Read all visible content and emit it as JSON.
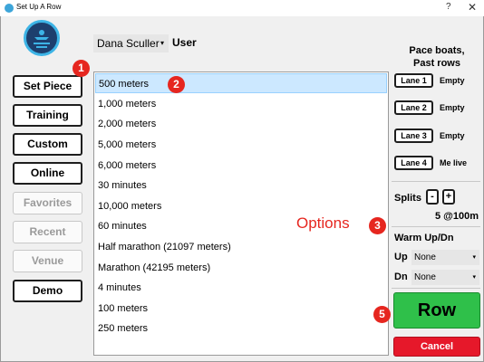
{
  "window": {
    "title": "Set Up A Row",
    "help_glyph": "?",
    "close_glyph": "✕"
  },
  "user": {
    "selected": "Dana Sculler",
    "label": "User"
  },
  "menu": [
    {
      "label": "Set Piece",
      "enabled": true
    },
    {
      "label": "Training",
      "enabled": true
    },
    {
      "label": "Custom",
      "enabled": true
    },
    {
      "label": "Online",
      "enabled": true
    },
    {
      "label": "Favorites",
      "enabled": false
    },
    {
      "label": "Recent",
      "enabled": false
    },
    {
      "label": "Venue",
      "enabled": false
    },
    {
      "label": "Demo",
      "enabled": true
    }
  ],
  "list": {
    "selected_index": 0,
    "items": [
      "500 meters",
      "1,000 meters",
      "2,000 meters",
      "5,000 meters",
      "6,000 meters",
      "30 minutes",
      "10,000 meters",
      "60 minutes",
      "Half marathon (21097 meters)",
      "Marathon (42195 meters)",
      "4 minutes",
      "100 meters",
      "250 meters"
    ]
  },
  "pace": {
    "heading_line1": "Pace boats,",
    "heading_line2": "Past rows",
    "lanes": [
      {
        "label": "Lane 1",
        "status": "Empty"
      },
      {
        "label": "Lane 2",
        "status": "Empty"
      },
      {
        "label": "Lane 3",
        "status": "Empty"
      },
      {
        "label": "Lane 4",
        "status": "Me live"
      }
    ]
  },
  "splits": {
    "label": "Splits",
    "minus": "-",
    "plus": "+",
    "value": "5 @100m"
  },
  "warmup": {
    "label": "Warm Up/Dn",
    "up_label": "Up",
    "up_value": "None",
    "dn_label": "Dn",
    "dn_value": "None"
  },
  "actions": {
    "row": "Row",
    "cancel": "Cancel"
  },
  "annotations": {
    "badge1": "1",
    "badge2": "2",
    "badge3": "3",
    "badge5": "5",
    "options": "Options"
  },
  "colors": {
    "accent_red": "#e6261f",
    "row_green": "#2fc04a",
    "cancel_red": "#e6182a",
    "selection_blue": "#cce8ff"
  }
}
